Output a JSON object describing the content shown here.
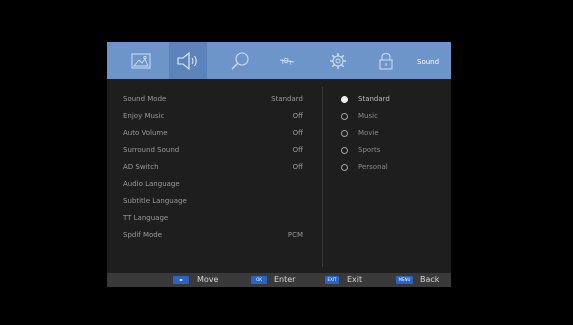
{
  "menu": {
    "title": "Sound",
    "icons": [
      {
        "name": "picture-icon",
        "selected": false
      },
      {
        "name": "sound-icon",
        "selected": true
      },
      {
        "name": "search-icon",
        "selected": false
      },
      {
        "name": "satellite-icon",
        "selected": false
      },
      {
        "name": "gear-icon",
        "selected": false
      },
      {
        "name": "lock-icon",
        "selected": false
      }
    ]
  },
  "settings": [
    {
      "label": "Sound Mode",
      "value": "Standard"
    },
    {
      "label": "Enjoy Music",
      "value": "Off"
    },
    {
      "label": "Auto Volume",
      "value": "Off"
    },
    {
      "label": "Surround Sound",
      "value": "Off"
    },
    {
      "label": "AD Switch",
      "value": "Off"
    },
    {
      "label": "Audio Language",
      "value": ""
    },
    {
      "label": "Subtitle Language",
      "value": ""
    },
    {
      "label": "TT Language",
      "value": ""
    },
    {
      "label": "Spdif Mode",
      "value": "PCM"
    }
  ],
  "options": [
    {
      "label": "Standard",
      "selected": true
    },
    {
      "label": "Music",
      "selected": false
    },
    {
      "label": "Movie",
      "selected": false
    },
    {
      "label": "Sports",
      "selected": false
    },
    {
      "label": "Personal",
      "selected": false
    }
  ],
  "footer": {
    "move": {
      "key": "◂▸",
      "label": "Move"
    },
    "enter": {
      "key": "OK",
      "label": "Enter"
    },
    "exit": {
      "key": "EXIT",
      "label": "Exit"
    },
    "back": {
      "key": "MENU",
      "label": "Back"
    }
  },
  "colors": {
    "header": "#6e95c9",
    "panel": "#1e1e1e",
    "footer": "#3a3a3a",
    "key": "#2a64c4"
  }
}
